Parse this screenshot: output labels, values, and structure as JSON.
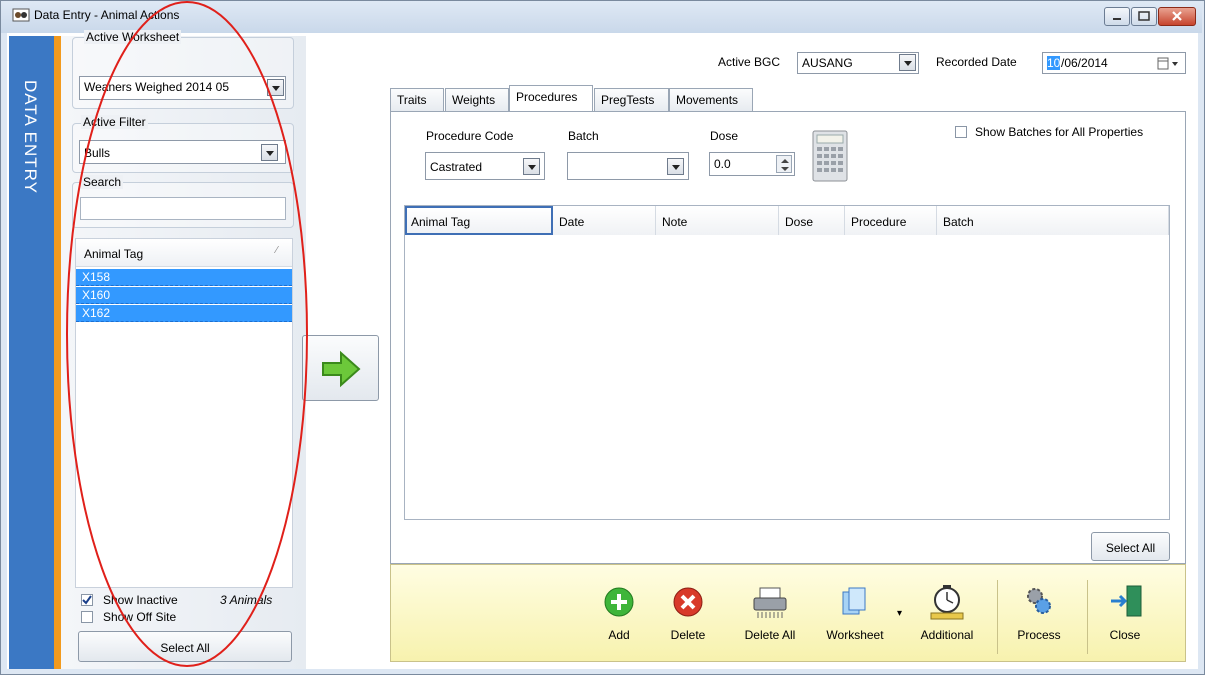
{
  "window": {
    "title": "Data Entry - Animal Actions"
  },
  "sidebar": {
    "label": "DATA ENTRY",
    "accent": "#3b78c4",
    "stripe": "#f29a1e"
  },
  "left": {
    "worksheet_label": "Active Worksheet",
    "worksheet_value": "Weaners Weighed 2014 05",
    "filter_label": "Active Filter",
    "filter_value": "Bulls",
    "search_label": "Search",
    "search_value": "",
    "list_header": "Animal Tag",
    "animals": [
      "X158",
      "X160",
      "X162"
    ],
    "show_inactive": "Show Inactive",
    "show_inactive_checked": true,
    "show_offsite": "Show Off Site",
    "show_offsite_checked": false,
    "count": "3 Animals",
    "select_all": "Select All"
  },
  "header": {
    "bgc_label": "Active BGC",
    "bgc_value": "AUSANG",
    "date_label": "Recorded Date",
    "date_day": "10",
    "date_rest": "/06/2014"
  },
  "tabs": [
    "Traits",
    "Weights",
    "Procedures",
    "PregTests",
    "Movements"
  ],
  "active_tab": "Procedures",
  "procedures": {
    "code_label": "Procedure Code",
    "code_value": "Castrated",
    "batch_label": "Batch",
    "batch_value": "",
    "dose_label": "Dose",
    "dose_value": "0.0",
    "show_batches": "Show Batches for All Properties",
    "grid_columns": [
      "Animal Tag",
      "Date",
      "Note",
      "Dose",
      "Procedure",
      "Batch"
    ],
    "select_all": "Select All"
  },
  "toolbar": {
    "add": "Add",
    "delete": "Delete",
    "delete_all": "Delete All",
    "worksheet": "Worksheet",
    "additional": "Additional",
    "process": "Process",
    "close": "Close"
  }
}
